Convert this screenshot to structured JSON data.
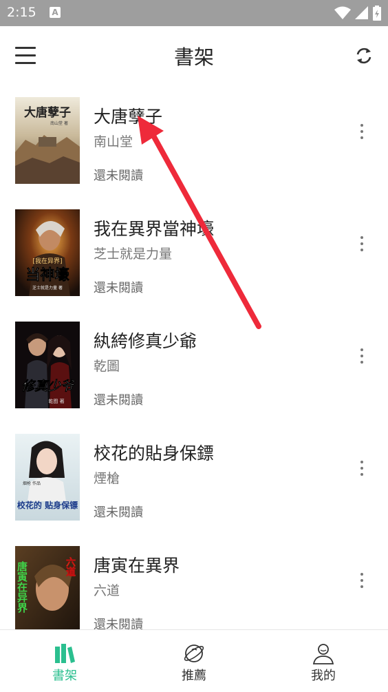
{
  "status_bar": {
    "time": "2:15",
    "notification_letter": "A"
  },
  "header": {
    "title": "書架"
  },
  "books": [
    {
      "title": "大唐孽子",
      "author": "南山堂",
      "status": "還未閱讀",
      "cover_title": "大唐孽子",
      "cover_author": "南山堂 著"
    },
    {
      "title": "我在異界當神壕",
      "author": "芝士就是力量",
      "status": "還未閱讀",
      "cover_title": "当神壕",
      "cover_subtitle": "[我在异界]",
      "cover_author": "芝士就是力量 著"
    },
    {
      "title": "紈絝修真少爺",
      "author": "乾圖",
      "status": "還未閱讀",
      "cover_title": "修真少爷",
      "cover_author": "乾图 著"
    },
    {
      "title": "校花的貼身保鏢",
      "author": "煙槍",
      "status": "還未閱讀",
      "cover_title": "校花的 贴身保镖",
      "cover_author": "烟枪 作品"
    },
    {
      "title": "唐寅在異界",
      "author": "六道",
      "status": "還未閱讀",
      "cover_title": "唐寅在异界",
      "cover_author": "六道"
    }
  ],
  "bottom_nav": [
    {
      "label": "書架",
      "icon": "bookshelf-icon",
      "active": true
    },
    {
      "label": "推薦",
      "icon": "planet-icon",
      "active": false
    },
    {
      "label": "我的",
      "icon": "person-icon",
      "active": false
    }
  ],
  "colors": {
    "accent": "#2bbf8f",
    "status_bar": "#9e9e9e",
    "annotation_arrow": "#ee2a3a"
  }
}
